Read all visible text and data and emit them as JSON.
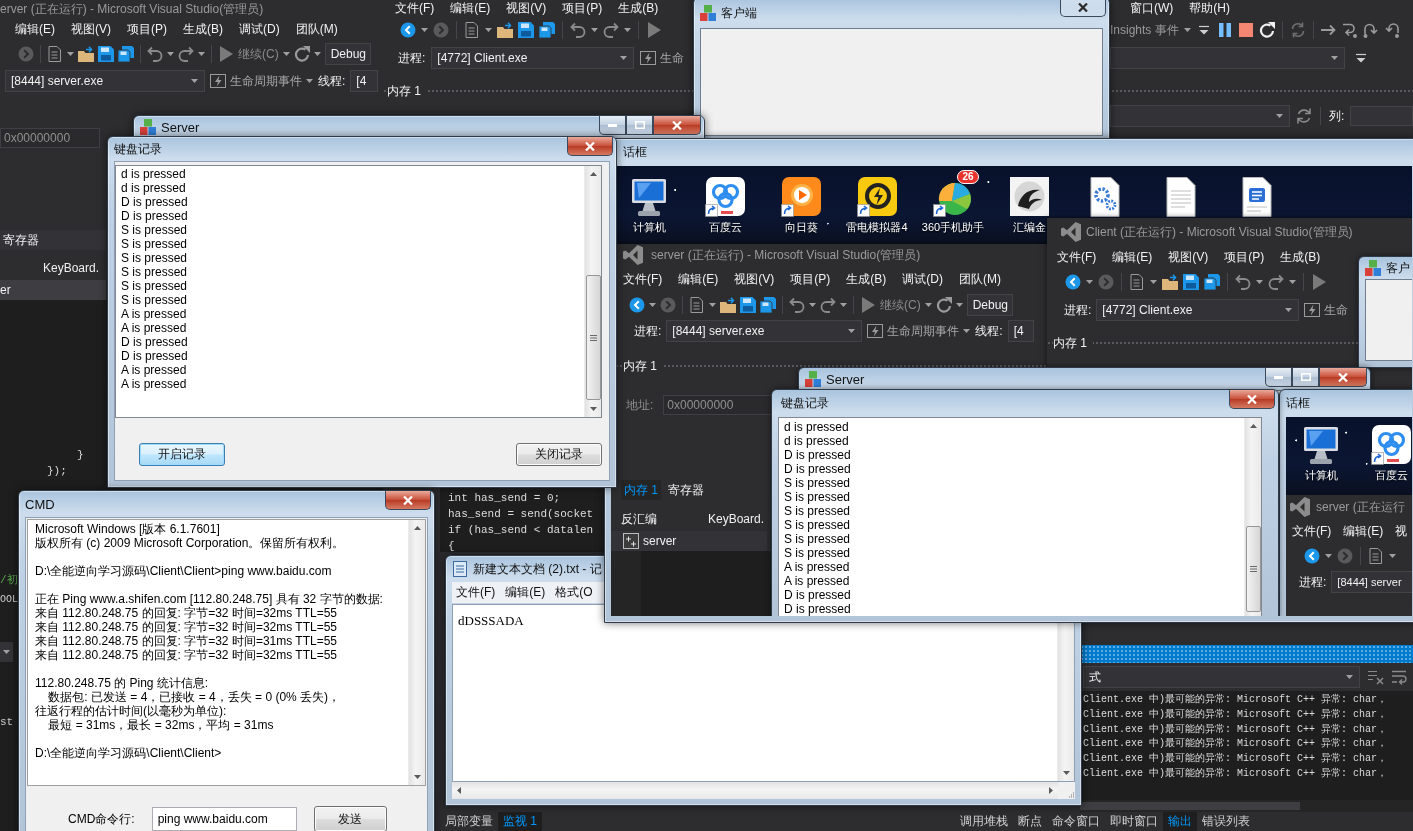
{
  "vs_server": {
    "title": "erver (正在运行) - Microsoft Visual Studio(管理员)",
    "menu": [
      "编辑(E)",
      "视图(V)",
      "项目(P)",
      "生成(B)",
      "调试(D)",
      "团队(M)"
    ],
    "continue": "继续(C)",
    "config": "Debug",
    "process": "[8444] server.exe",
    "lifecycle": "生命周期事件",
    "thread_label": "线程:",
    "thread": "[4",
    "address": "0x00000000",
    "tab": "寄存器",
    "document_tab": "KeyBoard.",
    "project": "er",
    "code": [
      "}",
      "});"
    ],
    "fragments": [
      "/初",
      "OOL",
      "st"
    ]
  },
  "vs_client": {
    "menu": [
      "文件(F)",
      "编辑(E)",
      "视图(V)",
      "项目(P)",
      "生成(B)"
    ],
    "menu_right": [
      "窗口(W)",
      "帮助(H)"
    ],
    "insights": "Insights 事件",
    "process_label": "进程:",
    "process": "[4772] Client.exe",
    "lifecycle": "生命",
    "memory_panel": "内存 1",
    "column_label": "列:",
    "code": [
      "int has_send = 0;",
      "has_send = send(socket",
      "if (has_send < datalen",
      "{"
    ],
    "output": {
      "source": "式",
      "lines": [
        "Client.exe 中)最可能的异常: Microsoft C++ 异常: char，",
        "Client.exe 中)最可能的异常: Microsoft C++ 异常: char，",
        "Client.exe 中)最可能的异常: Microsoft C++ 异常: char，",
        "Client.exe 中)最可能的异常: Microsoft C++ 异常: char，",
        "Client.exe 中)最可能的异常: Microsoft C++ 异常: char，",
        "Client.exe 中)最可能的异常: Microsoft C++ 异常: char，"
      ]
    },
    "watch_tabs": [
      {
        "label": "局部变量",
        "selected": false
      },
      {
        "label": "监视 1",
        "selected": true
      }
    ],
    "tool_tabs": [
      {
        "label": "调用堆栈",
        "selected": false
      },
      {
        "label": "断点",
        "selected": false
      },
      {
        "label": "命令窗口",
        "selected": false
      },
      {
        "label": "即时窗口",
        "selected": false
      },
      {
        "label": "输出",
        "selected": true
      },
      {
        "label": "错误列表",
        "selected": false
      }
    ]
  },
  "client_window": {
    "title": "客户端"
  },
  "server_window": {
    "title": "Server"
  },
  "keylog": {
    "title": "键盘记录",
    "entries": [
      "d is pressed",
      "d is pressed",
      "D is pressed",
      "D is pressed",
      "S is pressed",
      "S is pressed",
      "S is pressed",
      "S is pressed",
      "S is pressed",
      "S is pressed",
      "A is pressed",
      "A is pressed",
      "D is pressed",
      "D is pressed",
      "A is pressed",
      "A is pressed"
    ],
    "buttons": [
      {
        "label": "开启记录",
        "focused": true
      },
      {
        "label": "关闭记录",
        "focused": false
      }
    ]
  },
  "remote_window": {
    "title": "话框",
    "desktop_icons": [
      {
        "kind": "computer",
        "label": "计算机"
      },
      {
        "kind": "cloud",
        "label": "百度云"
      },
      {
        "kind": "sunflower",
        "label": "向日葵"
      },
      {
        "kind": "emulator",
        "label": "雷电模拟器4"
      },
      {
        "kind": "ball",
        "label": "360手机助手",
        "badge": "26"
      },
      {
        "kind": "dragon",
        "label": "汇编金"
      },
      {
        "kind": "gear_document"
      },
      {
        "kind": "document"
      },
      {
        "kind": "text_document"
      }
    ],
    "vs_server": {
      "title": "server (正在运行) - Microsoft Visual Studio(管理员)",
      "menu": [
        "文件(F)",
        "编辑(E)",
        "视图(V)",
        "项目(P)",
        "生成(B)",
        "调试(D)",
        "团队(M)"
      ],
      "continue": "继续(C)",
      "config": "Debug",
      "process_label": "进程:",
      "process": "[8444] server.exe",
      "lifecycle": "生命周期事件",
      "thread_label": "线程:",
      "thread": "[4",
      "memory_panel": "内存 1",
      "address_label": "地址:",
      "address": "0x00000000",
      "tabs": [
        {
          "label": "内存 1",
          "selected": true
        },
        {
          "label": "寄存器",
          "selected": false
        }
      ],
      "disassembly": "反汇编",
      "document_tab": "KeyBoard.",
      "project": "server"
    },
    "vs_client": {
      "title": "Client (正在运行) - Microsoft Visual Studio(管理员)",
      "menu": [
        "文件(F)",
        "编辑(E)",
        "视图(V)",
        "项目(P)",
        "生成(B)"
      ],
      "process_label": "进程:",
      "process": "[4772] Client.exe",
      "lifecycle": "生命",
      "memory_panel": "内存 1"
    },
    "client_window": {
      "title": "客户"
    },
    "server_window": {
      "title": "Server"
    },
    "keylog": {
      "title": "键盘记录",
      "entries": [
        "d is pressed",
        "d is pressed",
        "D is pressed",
        "D is pressed",
        "S is pressed",
        "S is pressed",
        "S is pressed",
        "S is pressed",
        "S is pressed",
        "S is pressed",
        "A is pressed",
        "A is pressed",
        "D is pressed",
        "D is pressed"
      ]
    },
    "inner_window": {
      "title": "话框",
      "desktop_icons": [
        {
          "kind": "computer",
          "label": "计算机"
        },
        {
          "kind": "cloud",
          "label": "百度云"
        }
      ],
      "vs_title": "server (正在运行",
      "menu": [
        "文件(F)",
        "编辑(E)",
        "视"
      ],
      "process_label": "进程:",
      "process": "[8444] server"
    }
  },
  "notepad": {
    "title": "新建文本文档 (2).txt - 记",
    "menu": [
      "文件(F)",
      "编辑(E)",
      "格式(O"
    ],
    "content": "dDSSSADA"
  },
  "cmd": {
    "title": "CMD",
    "output": [
      [
        "Microsoft Windows [版本 6.1.7601]",
        "版权所有 (c) 2009 Microsoft Corporation。保留所有权利。"
      ],
      [
        "D:\\全能逆向学习源码\\Client\\Client>ping www.baidu.com"
      ],
      [
        "正在 Ping www.a.shifen.com [112.80.248.75] 具有 32 字节的数据:",
        "来自 112.80.248.75 的回复: 字节=32 时间=32ms TTL=55",
        "来自 112.80.248.75 的回复: 字节=32 时间=32ms TTL=55",
        "来自 112.80.248.75 的回复: 字节=32 时间=31ms TTL=55",
        "来自 112.80.248.75 的回复: 字节=32 时间=32ms TTL=55"
      ],
      [
        "112.80.248.75 的 Ping 统计信息:",
        "    数据包: 已发送 = 4，已接收 = 4，丢失 = 0 (0% 丢失)，",
        "往返行程的估计时间(以毫秒为单位):",
        "    最短 = 31ms，最长 = 32ms，平均 = 31ms"
      ],
      [
        "D:\\全能逆向学习源码\\Client\\Client>"
      ]
    ],
    "label": "CMD命令行:",
    "input": "ping www.baidu.com",
    "button": "发送"
  }
}
